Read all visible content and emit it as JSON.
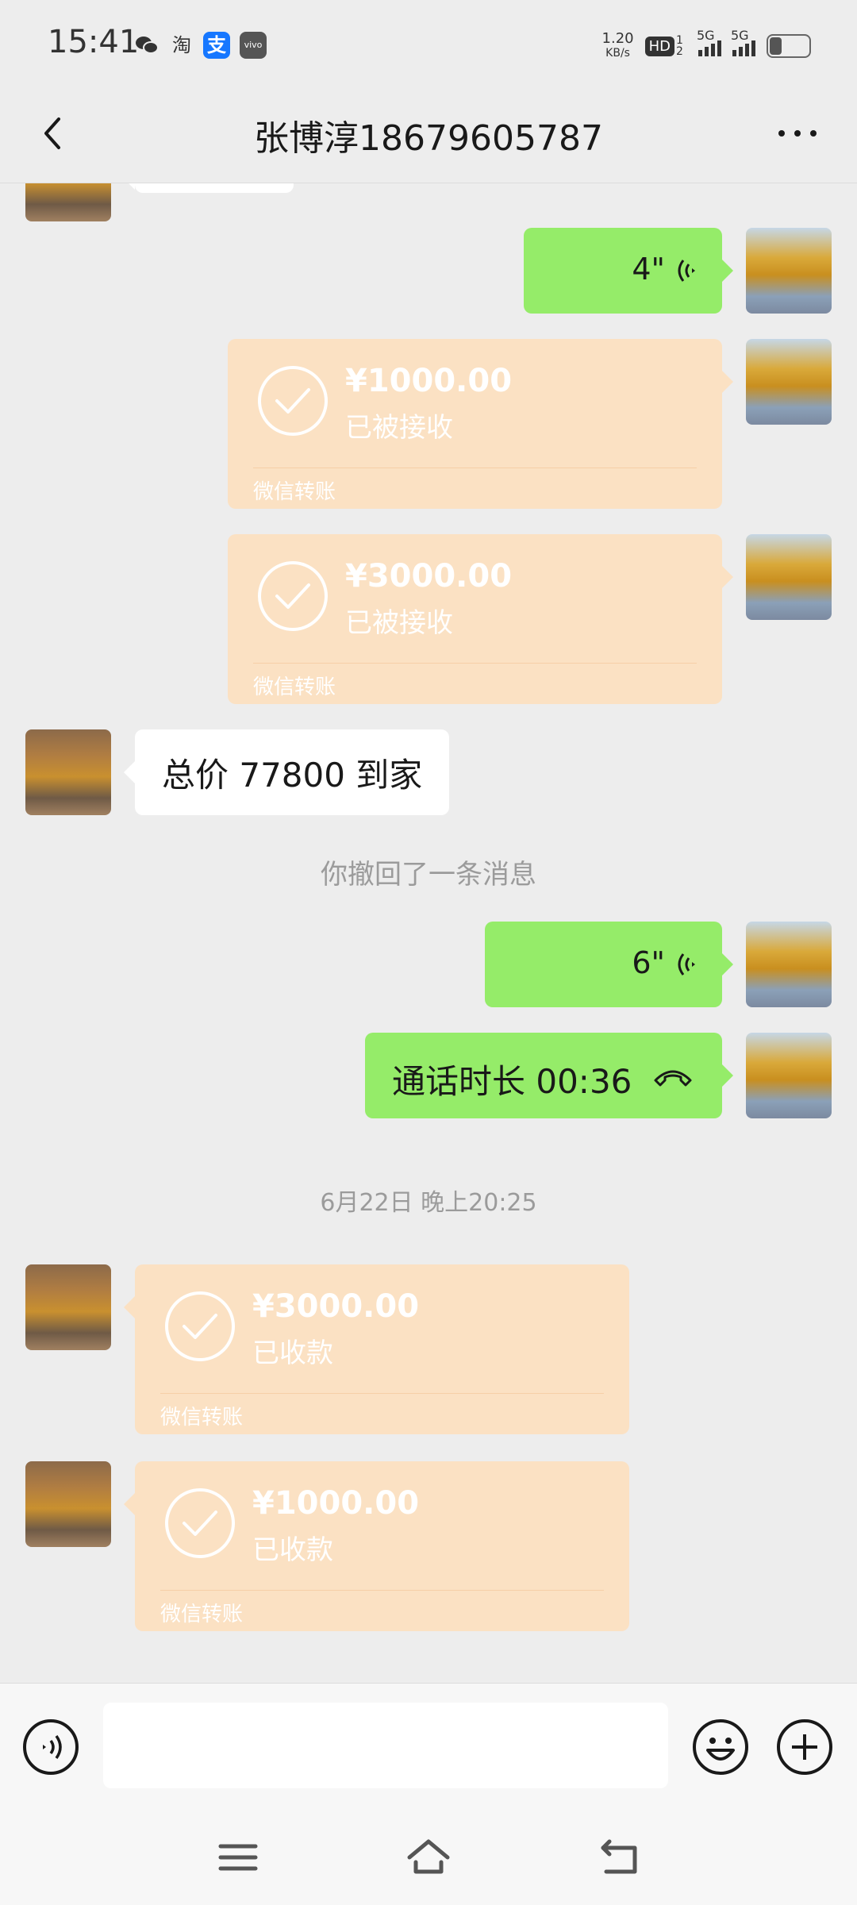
{
  "status_bar": {
    "time": "15:41",
    "icons": [
      "wechat-icon",
      "taobao-icon",
      "alipay-icon",
      "vivo-icon"
    ],
    "taobao_glyph": "淘",
    "alipay_glyph": "支",
    "vivo_text": "vivo",
    "net_speed_value": "1.20",
    "net_speed_unit": "KB/s",
    "hd_label": "HD",
    "hd_sub": "1 2",
    "sim1_label": "5G",
    "sim2_label": "5G",
    "battery_level": 0.35
  },
  "header": {
    "title": "张博淳18679605787",
    "back_icon": "chevron-left-icon",
    "more_icon": "more-dots-icon"
  },
  "messages": [
    {
      "type": "voice",
      "side": "right",
      "duration": "4\""
    },
    {
      "type": "transfer",
      "side": "right",
      "amount": "¥1000.00",
      "status": "已被接收",
      "footer": "微信转账"
    },
    {
      "type": "transfer",
      "side": "right",
      "amount": "¥3000.00",
      "status": "已被接收",
      "footer": "微信转账"
    },
    {
      "type": "text",
      "side": "left",
      "text": "总价 77800 到家"
    },
    {
      "type": "system",
      "text": "你撤回了一条消息"
    },
    {
      "type": "voice",
      "side": "right",
      "duration": "6\""
    },
    {
      "type": "call",
      "side": "right",
      "text": "通话时长 00:36"
    },
    {
      "type": "timestamp",
      "text": "6月22日 晚上20:25"
    },
    {
      "type": "transfer",
      "side": "left",
      "amount": "¥3000.00",
      "status": "已收款",
      "footer": "微信转账"
    },
    {
      "type": "transfer",
      "side": "left",
      "amount": "¥1000.00",
      "status": "已收款",
      "footer": "微信转账"
    }
  ],
  "input_bar": {
    "value": "",
    "voice_icon": "voice-input-icon",
    "emoji_icon": "emoji-icon",
    "plus_icon": "plus-icon"
  },
  "nav_bar": {
    "icons": [
      "menu-icon",
      "home-icon",
      "back-nav-icon"
    ]
  },
  "colors": {
    "bg": "#ededed",
    "green_bubble": "#95ec69",
    "transfer_bubble": "#fbe1c3",
    "system_text": "#9b9b9b"
  }
}
